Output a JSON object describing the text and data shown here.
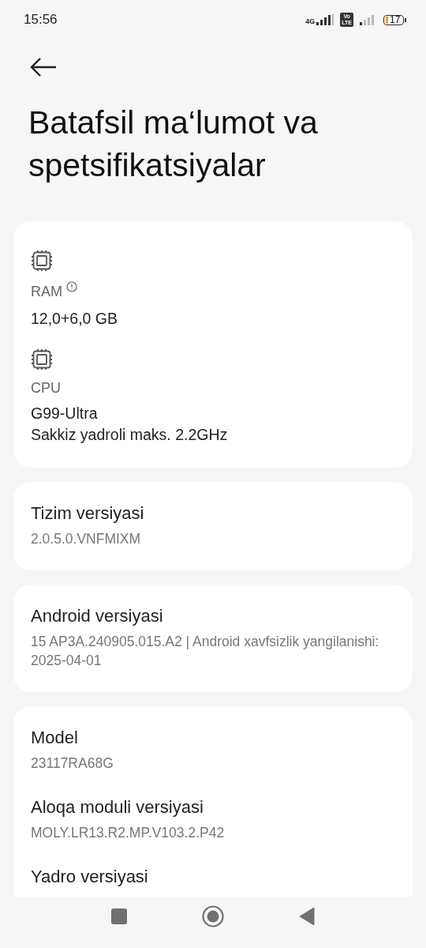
{
  "status_bar": {
    "time": "15:56",
    "network": "4G",
    "volte": [
      "Vo",
      "LTE"
    ],
    "battery": "17"
  },
  "title": "Batafsil ma‘lumot va spetsifikatsiyalar",
  "cards": [
    {
      "items": [
        {
          "kind": "chip",
          "label": "RAM",
          "info_icon": true,
          "values": [
            "12,0+6,0 GB"
          ]
        },
        {
          "kind": "chip",
          "label": "CPU",
          "info_icon": false,
          "values": [
            "G99-Ultra",
            "Sakkiz yadroli maks. 2.2GHz"
          ]
        }
      ]
    },
    {
      "items": [
        {
          "kind": "plain",
          "title": "Tizim versiyasi",
          "value": "2.0.5.0.VNFMIXM"
        }
      ]
    },
    {
      "items": [
        {
          "kind": "plain",
          "title": "Android versiyasi",
          "value": "15 AP3A.240905.015.A2 | Android xavfsizlik yangilanishi: 2025-04-01"
        }
      ]
    },
    {
      "items": [
        {
          "kind": "plain",
          "title": "Model",
          "value": "23117RA68G"
        },
        {
          "kind": "plain",
          "title": "Aloqa moduli versiyasi",
          "value": "MOLY.LR13.R2.MP.V103.2.P42"
        },
        {
          "kind": "plain",
          "title": "Yadro versiyasi"
        }
      ]
    }
  ]
}
